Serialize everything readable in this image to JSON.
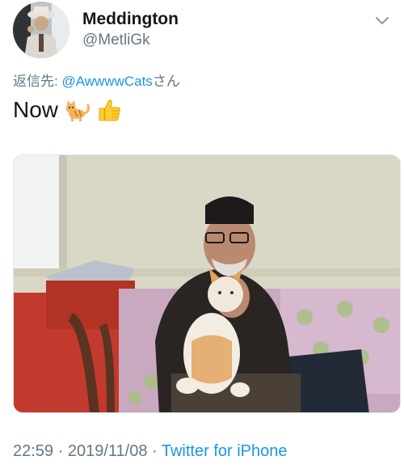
{
  "tweet": {
    "author": {
      "display_name": "Meddington",
      "handle": "@MetliGk"
    },
    "reply_prefix": "返信先: ",
    "reply_to": "@AwwwwCats",
    "reply_suffix": "さん",
    "text": "Now",
    "emojis": [
      "cat-emoji",
      "thumbs-up-emoji"
    ],
    "timestamp": "22:59 · 2019/11/08 · ",
    "source": "Twitter for iPhone"
  },
  "colors": {
    "link": "#1b95e0",
    "secondary_text": "#657786",
    "primary_text": "#14171a"
  }
}
